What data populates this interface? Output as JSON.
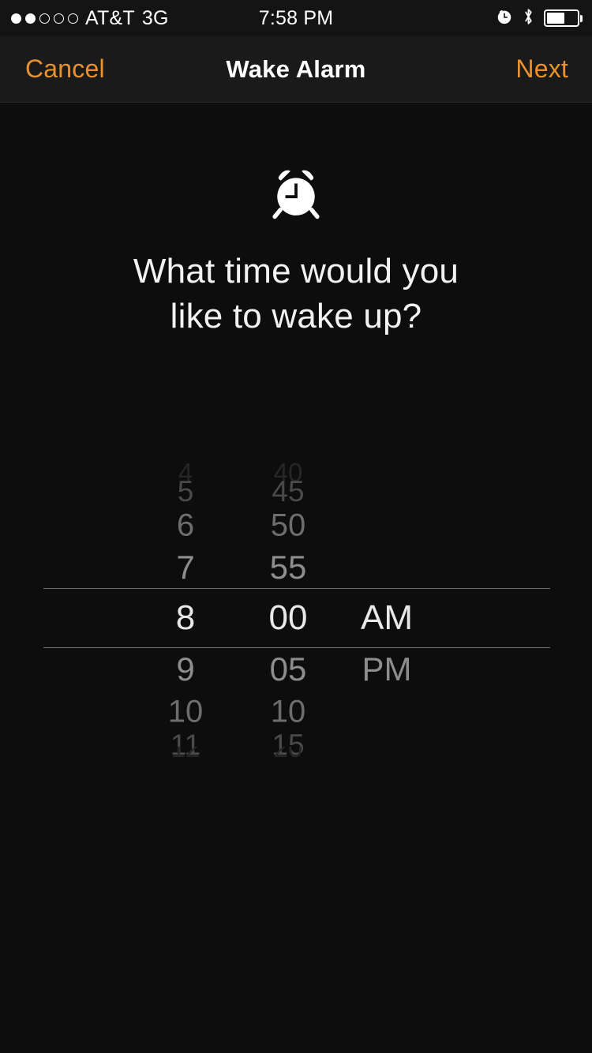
{
  "status_bar": {
    "signal_dots_total": 5,
    "signal_dots_filled": 2,
    "carrier": "AT&T",
    "network": "3G",
    "time": "7:58 PM",
    "icons": [
      "alarm-clock-icon",
      "bluetooth-icon",
      "battery-icon"
    ],
    "battery_percent": 60
  },
  "nav_bar": {
    "cancel_label": "Cancel",
    "title": "Wake Alarm",
    "next_label": "Next",
    "accent_color": "#e8922f",
    "background_color": "#1a1a1a"
  },
  "content": {
    "icon": "alarm-clock-icon",
    "headline_line1": "What time would you",
    "headline_line2": "like to wake up?",
    "background_color": "#0d0d0d"
  },
  "picker": {
    "selected_hour": "8",
    "selected_minute": "00",
    "selected_period": "AM",
    "rows": [
      {
        "hour": "4",
        "minute": "40",
        "period": "",
        "dist": 4
      },
      {
        "hour": "5",
        "minute": "45",
        "period": "",
        "dist": 3
      },
      {
        "hour": "6",
        "minute": "50",
        "period": "",
        "dist": 2
      },
      {
        "hour": "7",
        "minute": "55",
        "period": "",
        "dist": 1
      },
      {
        "hour": "8",
        "minute": "00",
        "period": "AM",
        "dist": 0
      },
      {
        "hour": "9",
        "minute": "05",
        "period": "PM",
        "dist": 1
      },
      {
        "hour": "10",
        "minute": "10",
        "period": "",
        "dist": 2
      },
      {
        "hour": "11",
        "minute": "15",
        "period": "",
        "dist": 3
      },
      {
        "hour": "12",
        "minute": "20",
        "period": "",
        "dist": 4
      }
    ],
    "selection_line_color": "#6e6e6e"
  }
}
